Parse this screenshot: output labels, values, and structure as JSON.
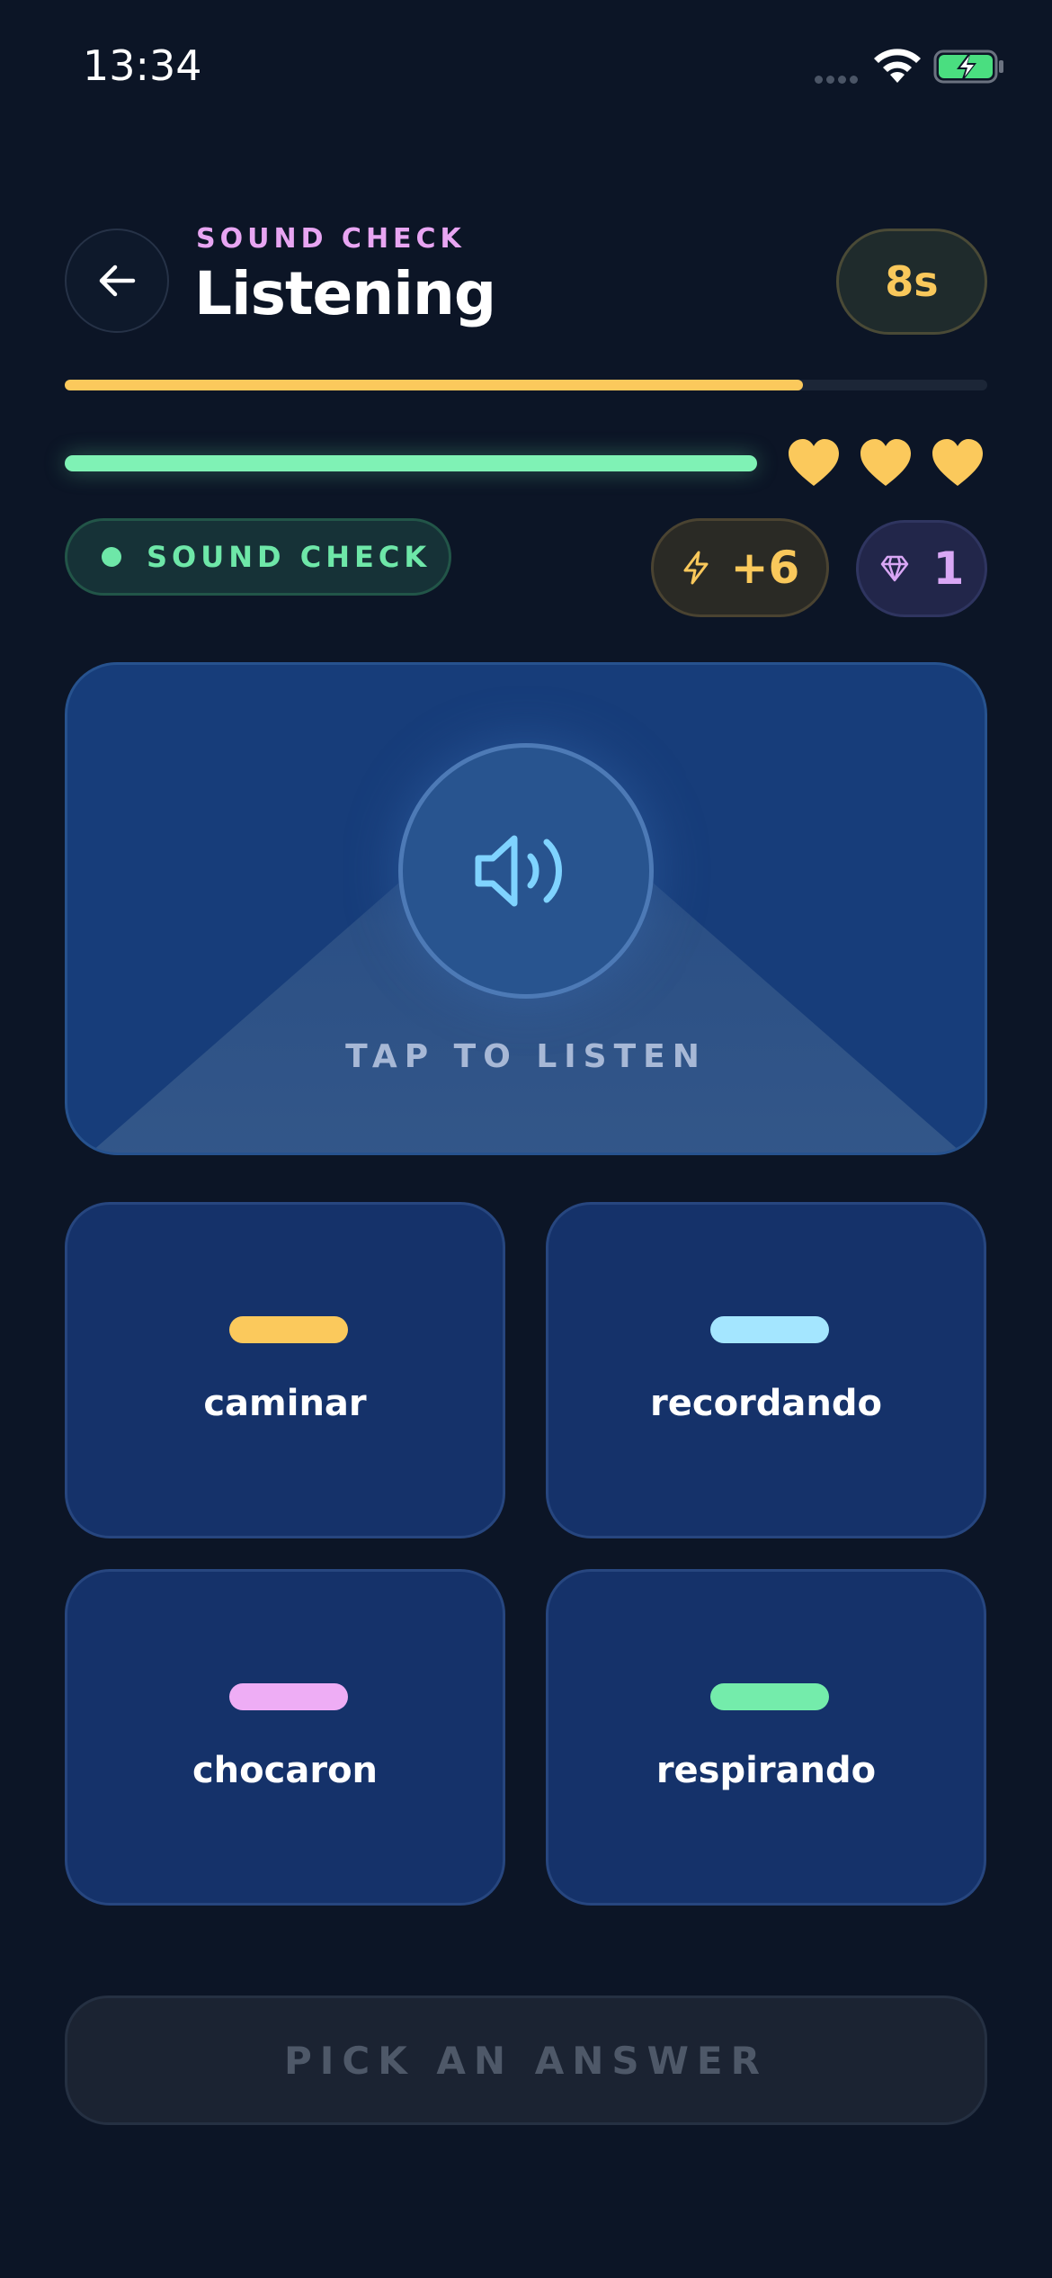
{
  "status_bar": {
    "time": "13:34"
  },
  "header": {
    "eyebrow": "SOUND CHECK",
    "title": "Listening",
    "timer": "8s"
  },
  "progress": {
    "fraction": 0.8
  },
  "lives": {
    "bar_fraction": 1.0,
    "hearts": 3
  },
  "chips": {
    "mode_label": "SOUND CHECK",
    "xp": "+6",
    "gems": "1"
  },
  "listen": {
    "label": "TAP TO LISTEN"
  },
  "answers": [
    {
      "word": "caminar",
      "color": "#fbc95c"
    },
    {
      "word": "recordando",
      "color": "#a4e6ff"
    },
    {
      "word": "chocaron",
      "color": "#eeadf5"
    },
    {
      "word": "respirando",
      "color": "#74ecab"
    }
  ],
  "footer": {
    "button_label": "PICK AN ANSWER"
  },
  "colors": {
    "background": "#0c1526",
    "accent_yellow": "#fbc95c",
    "accent_green": "#6ee7a8",
    "accent_pink": "#e8a5f2",
    "card_blue": "#15326a"
  }
}
